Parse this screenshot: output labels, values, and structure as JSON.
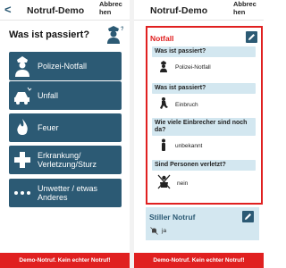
{
  "header": {
    "back_symbol": "<",
    "title": "Notruf-Demo",
    "cancel_label": "Abbrechen"
  },
  "left": {
    "heading": "Was ist passiert?",
    "categories": [
      {
        "label": "Polizei-Notfall",
        "icon": "police-officer-icon"
      },
      {
        "label": "Unfall",
        "icon": "car-crash-icon"
      },
      {
        "label": "Feuer",
        "icon": "fire-icon"
      },
      {
        "label": "Erkrankung/ Verletzung/Sturz",
        "icon": "medical-cross-icon"
      },
      {
        "label": "Unwetter / etwas Anderes",
        "icon": "more-dots-icon"
      }
    ]
  },
  "right": {
    "notfall_title": "Notfall",
    "items": [
      {
        "question": "Was ist passiert?",
        "answer": "Polizei-Notfall",
        "icon": "police-officer-icon"
      },
      {
        "question": "Was ist passiert?",
        "answer": "Einbruch",
        "icon": "burglar-icon"
      },
      {
        "question": "Wie viele Einbrecher sind noch da?",
        "answer": "unbekannt",
        "icon": "person-icon"
      },
      {
        "question": "Sind Personen verletzt?",
        "answer": "nein",
        "icon": "injured-crossed-icon"
      }
    ],
    "stiller_title": "Stiller Notruf",
    "stiller_value": "ja",
    "stiller_icon": "bell-muted-icon"
  },
  "footer_text": "Demo-Notruf. Kein echter Notruf!",
  "colors": {
    "primary": "#2c5a74",
    "alert": "#e02020",
    "light": "#d3e7f0"
  }
}
